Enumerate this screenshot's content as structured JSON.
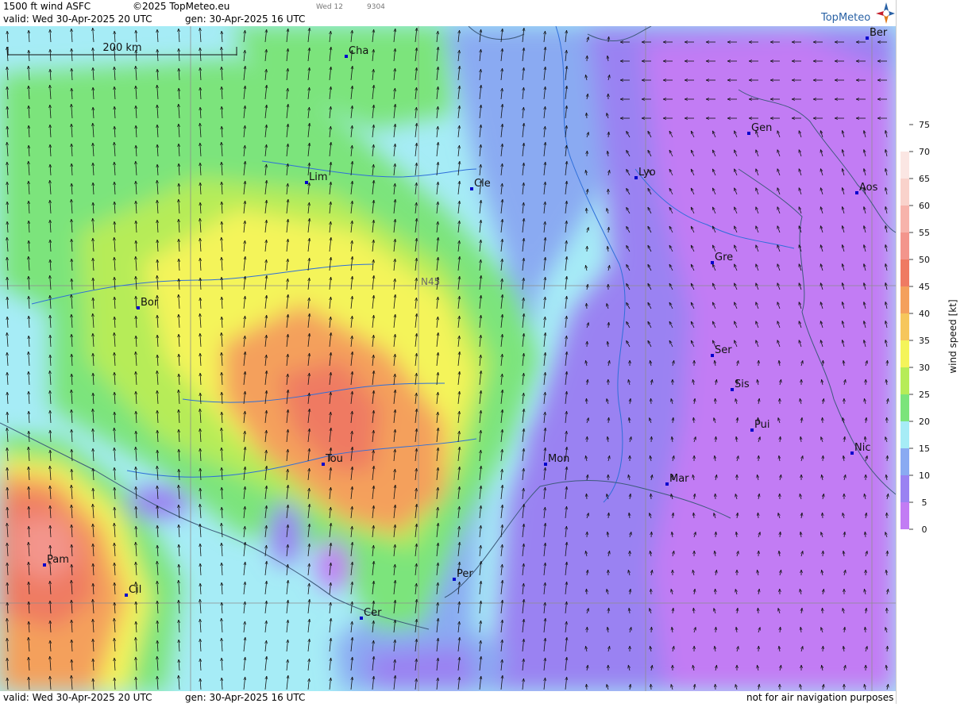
{
  "header": {
    "product": "1500 ft wind ASFC",
    "copyright": "©2025 TopMeteo.eu",
    "valid": "valid:  Wed  30-Apr-2025  20 UTC",
    "gen": "gen: 30-Apr-2025 16 UTC",
    "run_day": "Wed 12",
    "code": "9304"
  },
  "footer": {
    "valid": "valid:  Wed  30-Apr-2025  20 UTC",
    "gen": "gen: 30-Apr-2025 16 UTC",
    "disclaimer": "not for air navigation purposes"
  },
  "logo": {
    "text": "TopMeteo"
  },
  "scale_bar": {
    "label": "200 km"
  },
  "grid": {
    "lat_label": "N45"
  },
  "cities": [
    "Cha",
    "Ber",
    "Gen",
    "Lim",
    "Cle",
    "Lyo",
    "Aos",
    "Gre",
    "Bor",
    "Ser",
    "Sis",
    "Pui",
    "Tou",
    "Mon",
    "Mar",
    "Nic",
    "Pam",
    "Cil",
    "Per",
    "Cer"
  ],
  "legend": {
    "title": "wind speed [kt]",
    "ticks": [
      75,
      70,
      65,
      60,
      55,
      50,
      45,
      40,
      35,
      30,
      25,
      20,
      15,
      10,
      5,
      0
    ],
    "colors": [
      "#c27cf4",
      "#9a82f2",
      "#8aaaf2",
      "#a6ecf6",
      "#7be47b",
      "#b6ec58",
      "#f4f45a",
      "#f6c65c",
      "#f4a05c",
      "#ef7a62",
      "#f3958c",
      "#f7b3ab",
      "#f9d2cb",
      "#fbe6e3"
    ]
  },
  "colors": {
    "map_background": "#a6ecf6",
    "border_lines": "#3d5a7a",
    "river_lines": "#2f6fd9",
    "city_marker": "#0000cc",
    "arrow": "#111111"
  }
}
